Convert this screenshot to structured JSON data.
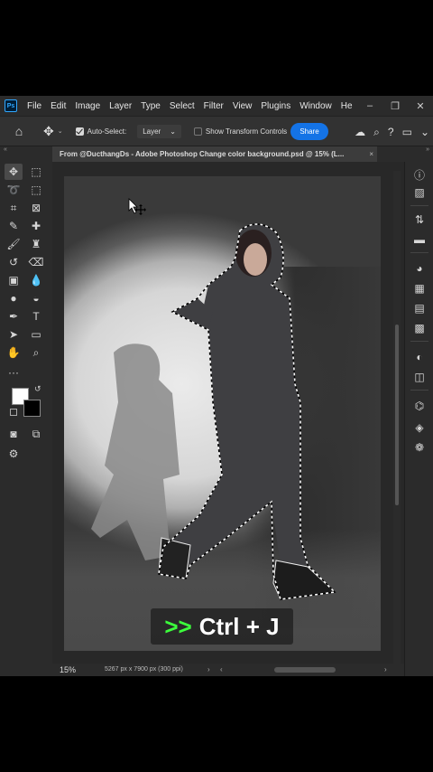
{
  "menubar": {
    "logo": "Ps",
    "items": [
      "File",
      "Edit",
      "Image",
      "Layer",
      "Type",
      "Select",
      "Filter",
      "View",
      "Plugins",
      "Window",
      "He"
    ],
    "window_controls": [
      "minimize-icon",
      "restore-icon",
      "close-icon"
    ]
  },
  "options": {
    "auto_select_label": "Auto-Select:",
    "auto_select_checked": true,
    "auto_select_value": "Layer",
    "show_transform_label": "Show Transform Controls",
    "show_transform_checked": false,
    "share_label": "Share",
    "accent": "#1473e6"
  },
  "document": {
    "tab_title": "From @DucthangDs - Adobe Photoshop Change color background.psd @ 15% (L...",
    "close_glyph": "×"
  },
  "status": {
    "zoom": "15%",
    "dimensions": "5267 px x 7900 px (300 ppi)"
  },
  "caption": {
    "arrow": ">>",
    "keys": "Ctrl + J",
    "arrow_color": "#3cff3c"
  },
  "colors": {
    "foreground": "#ffffff",
    "background": "#000000"
  }
}
